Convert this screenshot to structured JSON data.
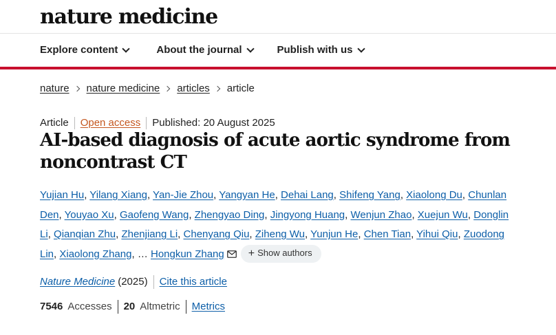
{
  "site": {
    "logo_text": "nature medicine"
  },
  "nav": {
    "items": [
      {
        "label": "Explore content"
      },
      {
        "label": "About the journal"
      },
      {
        "label": "Publish with us"
      }
    ]
  },
  "breadcrumb": {
    "items": [
      "nature",
      "nature medicine",
      "articles"
    ],
    "current": "article"
  },
  "article": {
    "type": "Article",
    "access": "Open access",
    "published": "Published: 20 August 2025",
    "title": "AI-based diagnosis of acute aortic syndrome from noncontrast CT",
    "authors": [
      "Yujian Hu",
      "Yilang Xiang",
      "Yan-Jie Zhou",
      "Yangyan He",
      "Dehai Lang",
      "Shifeng Yang",
      "Xiaolong Du",
      "Chunlan Den",
      "Youyao Xu",
      "Gaofeng Wang",
      "Zhengyao Ding",
      "Jingyong Huang",
      "Wenjun Zhao",
      "Xuejun Wu",
      "Donglin Li",
      "Qianqian Zhu",
      "Zhenjiang Li",
      "Chenyang Qiu",
      "Ziheng Wu",
      "Yunjun He",
      "Chen Tian",
      "Yihui Qiu",
      "Zuodong Lin",
      "Xiaolong Zhang"
    ],
    "ellipsis": "…",
    "corresponding_author": "Hongkun Zhang",
    "show_authors_label": "Show authors",
    "journal": "Nature Medicine",
    "year": "(2025)",
    "cite_label": "Cite this article",
    "accesses_count": "7546",
    "accesses_label": "Accesses",
    "altmetric_count": "20",
    "altmetric_label": "Altmetric",
    "metrics_label": "Metrics"
  },
  "colors": {
    "accent_red": "#c8102e",
    "link_blue": "#0c5ea8",
    "open_access_orange": "#c4561e"
  }
}
